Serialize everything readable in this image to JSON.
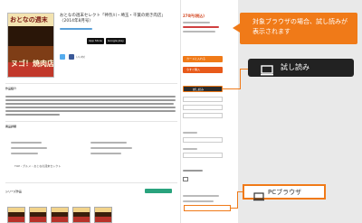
{
  "book": {
    "title": "おとなの週末セレクト「神奈川・埼玉・千葉の焼き肉店」〈2014年8月号〉",
    "cover_title": "おとなの週末",
    "cover_headline": "ヌゴ！焼肉店",
    "store_buttons": [
      "App Store",
      "Google play"
    ],
    "share_buttons": [
      "Tweet",
      "いいね！"
    ]
  },
  "description": {
    "heading": "作品紹介"
  },
  "detail": {
    "heading": "商品詳細"
  },
  "breadcrumb": [
    "TOP",
    "グルメ",
    "おとなの週末セレクト"
  ],
  "series": {
    "heading": "シリーズ作品"
  },
  "sidebar": {
    "price": "270円(税込)",
    "cart_button": "カートに入れる",
    "buy_button": "今すぐ購入",
    "trial_small": "試し読み"
  },
  "annotation": {
    "callout_text": "対象ブラウザの場合、試し読みが\n表示されます",
    "trial_button_label": "試し読み",
    "pc_browser_label": "PCブラウザ"
  },
  "colors": {
    "accent_orange": "#f07a18",
    "dark_button": "#222222"
  }
}
